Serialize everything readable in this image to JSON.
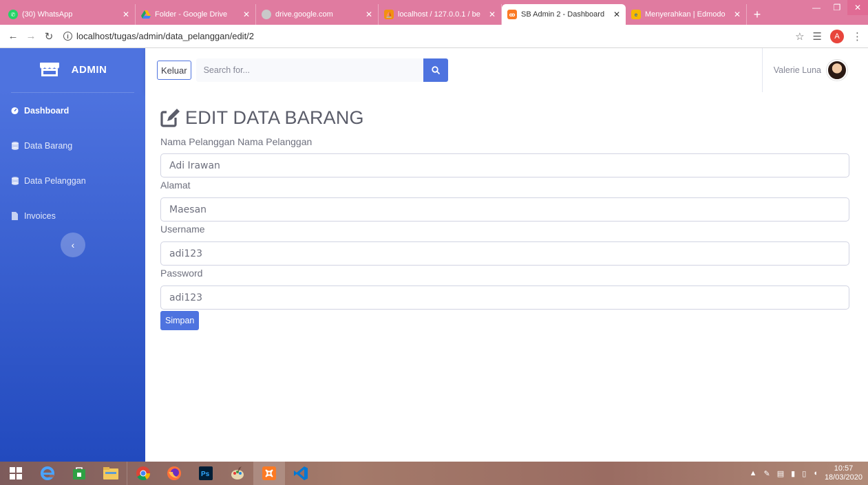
{
  "browser": {
    "tabs": [
      {
        "title": "(30) WhatsApp",
        "favicon_color": "#25d366",
        "active": false
      },
      {
        "title": "Folder - Google Drive",
        "favicon_color": "#fbbc04",
        "active": false
      },
      {
        "title": "drive.google.com",
        "favicon_color": "#aaaaaa",
        "active": false
      },
      {
        "title": "localhost / 127.0.0.1 / be",
        "favicon_color": "#f29111",
        "active": false
      },
      {
        "title": "SB Admin 2 - Dashboard",
        "favicon_color": "#fb7a24",
        "active": true
      },
      {
        "title": "Menyerahkan | Edmodo",
        "favicon_color": "#f5b800",
        "active": false
      }
    ],
    "new_tab_label": "+",
    "close_glyph": "✕",
    "url": "localhost/tugas/admin/data_pelanggan/edit/2",
    "profile_initial": "A"
  },
  "sidebar": {
    "brand": "ADMIN",
    "items": [
      {
        "label": "Dashboard",
        "icon": "dashboard-icon",
        "active": true
      },
      {
        "label": "Data Barang",
        "icon": "database-icon",
        "active": false
      },
      {
        "label": "Data Pelanggan",
        "icon": "database-icon",
        "active": false
      },
      {
        "label": "Invoices",
        "icon": "file-icon",
        "active": false
      }
    ],
    "toggle_glyph": "‹"
  },
  "topbar": {
    "logout_label": "Keluar",
    "search_placeholder": "Search for...",
    "user_name": "Valerie Luna"
  },
  "form": {
    "title": "EDIT DATA BARANG",
    "fields": [
      {
        "label": "Nama Pelanggan Nama Pelanggan",
        "value": "Adi Irawan"
      },
      {
        "label": "Alamat",
        "value": "Maesan"
      },
      {
        "label": "Username",
        "value": "adi123"
      },
      {
        "label": "Password",
        "value": "adi123"
      }
    ],
    "submit_label": "Simpan"
  },
  "taskbar": {
    "time": "10:57",
    "date": "18/03/2020"
  }
}
